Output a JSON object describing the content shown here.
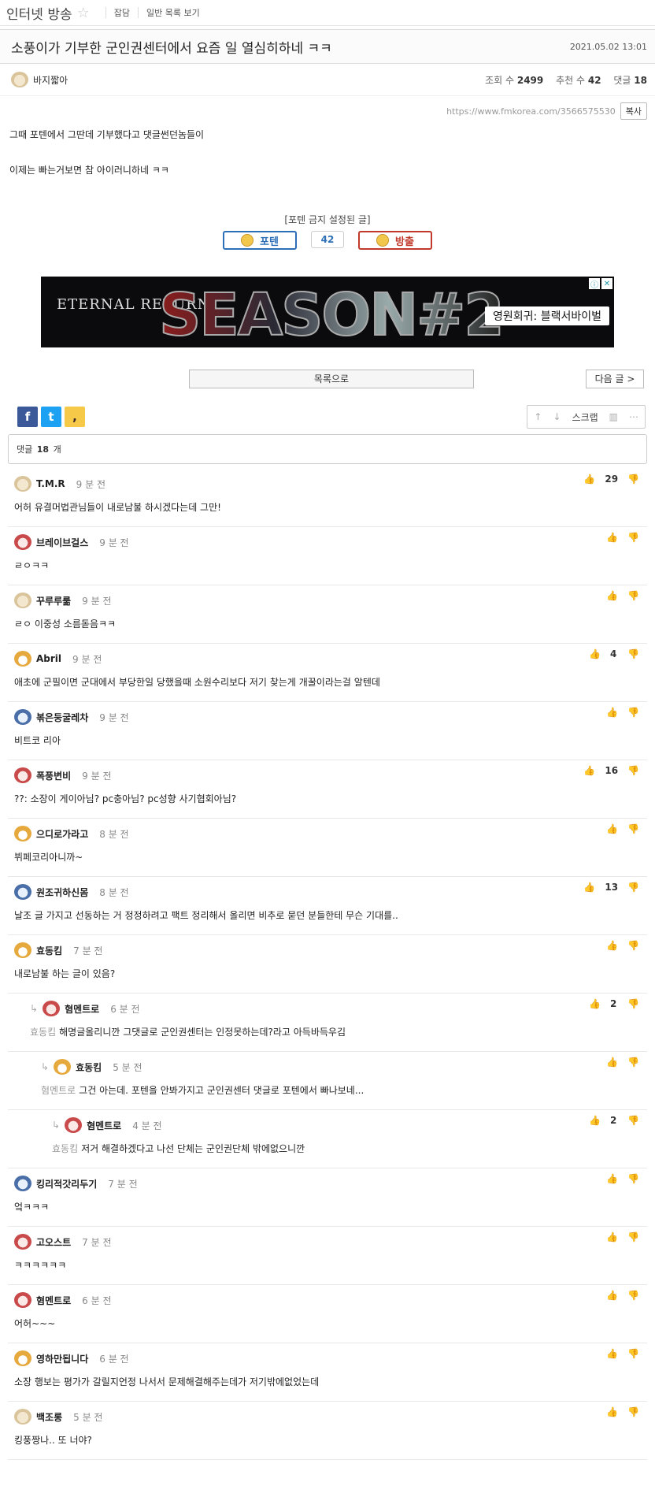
{
  "board": {
    "name": "인터넷 방송",
    "links": [
      "잡담",
      "일반 목록 보기"
    ]
  },
  "post": {
    "title": "소풍이가 기부한 군인권센터에서 요즘 일 열심히하네 ㅋㅋ",
    "date": "2021.05.02 13:01",
    "author": "바지짧아",
    "views_label": "조회 수",
    "views": "2499",
    "likes_label": "추천 수",
    "likes": "42",
    "comments_label": "댓글",
    "comments": "18",
    "url": "https://www.fmkorea.com/3566575530",
    "copy_label": "복사",
    "body": [
      "그때 포텐에서 그딴데 기부했다고 댓글썬던놈들이",
      "이제는 빠는거보면 참 아이러니하네 ㅋㅋ"
    ],
    "notice": "[포텐 금지 설정된 글]",
    "vote_up": "포텐",
    "vote_count": "42",
    "vote_down": "방출"
  },
  "banner": {
    "brand": "ETERNAL RETURN",
    "headline": "SEASON#2",
    "cta": "영원회귀: 블랙서바이벌"
  },
  "nav": {
    "list": "목록으로",
    "next": "다음 글 >"
  },
  "share": {
    "facebook": "f",
    "twitter": "t",
    "kakao": ","
  },
  "tools": {
    "scrap": "스크랩"
  },
  "comment_header": {
    "prefix": "댓글",
    "count": "18",
    "suffix": "개"
  },
  "comments": [
    {
      "nick": "T.M.R",
      "time": "9 분 전",
      "text": "어허 유결머법관님들이 내로남불 하시겠다는데 그만!",
      "likes": "29",
      "avatar": "dog",
      "depth": 0
    },
    {
      "nick": "브레이브걸스",
      "time": "9 분 전",
      "text": "ㄹㅇㅋㅋ",
      "likes": "",
      "avatar": "cat",
      "depth": 0
    },
    {
      "nick": "꾸루루룲",
      "time": "9 분 전",
      "text": "ㄹㅇ 이중성 소름돋음ㅋㅋ",
      "likes": "",
      "avatar": "dog",
      "depth": 0
    },
    {
      "nick": "Abril",
      "time": "9 분 전",
      "text": "애초에 군필이면 군대에서 부당한일 당했을때 소원수리보다 저기 찾는게 개꿀이라는걸 알텐데",
      "likes": "4",
      "avatar": "fox",
      "depth": 0
    },
    {
      "nick": "볶은둥굴레차",
      "time": "9 분 전",
      "text": "비트코 리아",
      "likes": "",
      "avatar": "blue",
      "depth": 0
    },
    {
      "nick": "폭풍변비",
      "time": "9 분 전",
      "text": "??: 소장이 게이아님? pc충아님? pc성향 사기협회아님?",
      "likes": "16",
      "avatar": "cat",
      "depth": 0
    },
    {
      "nick": "으디로가라고",
      "time": "8 분 전",
      "text": "뷔페코리아니까~",
      "likes": "",
      "avatar": "fox",
      "depth": 0
    },
    {
      "nick": "원조귀하신몸",
      "time": "8 분 전",
      "text": "날조 글 가지고 선동하는 거 정정하려고 팩트 정리해서 올리면 비추로 묻던 분들한테 무슨 기대를..",
      "likes": "13",
      "avatar": "blue",
      "depth": 0
    },
    {
      "nick": "효동킴",
      "time": "7 분 전",
      "text": "내로남불 하는 글이 있음?",
      "likes": "",
      "avatar": "fox",
      "depth": 0
    },
    {
      "nick": "혐멘트로",
      "time": "6 분 전",
      "reply_to": "효동킴",
      "text": "해명글올리니깐 그댓글로 군인권센터는 인정못하는데?라고 아득바득우김",
      "likes": "2",
      "avatar": "cat",
      "depth": 1
    },
    {
      "nick": "효동킴",
      "time": "5 분 전",
      "reply_to": "혐멘트로",
      "text": "그건 아는데. 포텐을 안봐가지고 군인권센터 댓글로 포텐에서 빠나보네...",
      "likes": "",
      "avatar": "fox",
      "depth": 2
    },
    {
      "nick": "혐멘트로",
      "time": "4 분 전",
      "reply_to": "효동킴",
      "text": "저거 해결하겠다고 나선 단체는 군인권단체 밖에없으니깐",
      "likes": "2",
      "avatar": "cat",
      "depth": 3
    },
    {
      "nick": "킹리적갓리두기",
      "time": "7 분 전",
      "text": "엌ㅋㅋㅋ",
      "likes": "",
      "avatar": "blue",
      "depth": 0
    },
    {
      "nick": "고오스트",
      "time": "7 분 전",
      "text": "ㅋㅋㅋㅋㅋㅋ",
      "likes": "",
      "avatar": "cat",
      "depth": 0
    },
    {
      "nick": "혐멘트로",
      "time": "6 분 전",
      "text": "어허~~~",
      "likes": "",
      "avatar": "cat",
      "depth": 0
    },
    {
      "nick": "영하만됩니다",
      "time": "6 분 전",
      "text": "소장 행보는 평가가 갈릴지언정 나서서 문제해결해주는데가 저기밖에없었는데",
      "likes": "",
      "avatar": "fox",
      "depth": 0
    },
    {
      "nick": "백조롱",
      "time": "5 분 전",
      "text": "킹풍짱나.. 또 너야?",
      "likes": "",
      "avatar": "dog",
      "depth": 0
    }
  ]
}
